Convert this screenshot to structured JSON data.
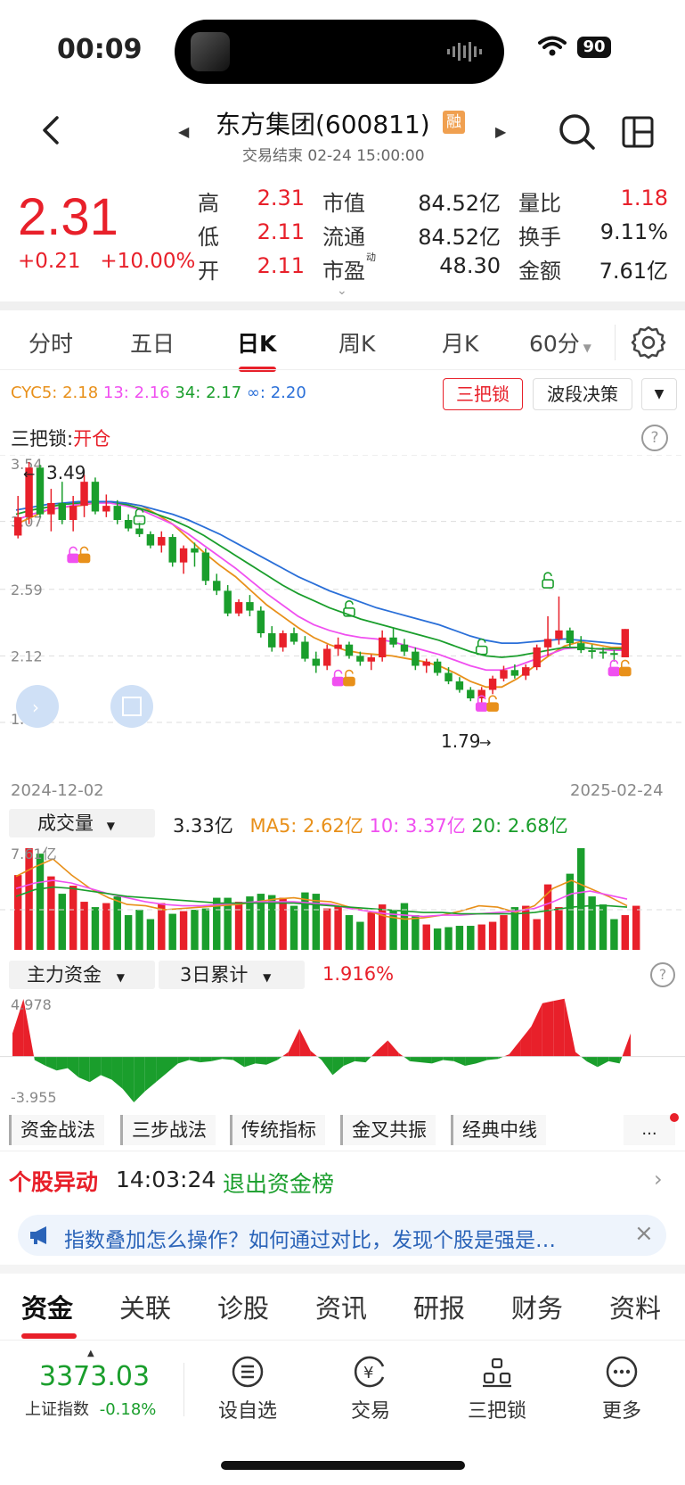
{
  "status_bar": {
    "time": "00:09",
    "battery": "90"
  },
  "header": {
    "title": "东方集团(600811)",
    "badge": "融",
    "trade_status": "交易结束 02-24 15:00:00"
  },
  "quote": {
    "price": "2.31",
    "change": "+0.21   +10.00%",
    "stats": [
      {
        "label": "高",
        "value": "2.31",
        "color": "red"
      },
      {
        "label": "低",
        "value": "2.11",
        "color": "red"
      },
      {
        "label": "开",
        "value": "2.11",
        "color": "red"
      },
      {
        "label": "市值",
        "value": "84.52亿",
        "color": "black"
      },
      {
        "label": "流通",
        "value": "84.52亿",
        "color": "black"
      },
      {
        "label": "市盈",
        "label_sup": "动",
        "value": "48.30",
        "color": "black"
      },
      {
        "label": "量比",
        "value": "1.18",
        "color": "red"
      },
      {
        "label": "换手",
        "value": "9.11%",
        "color": "black"
      },
      {
        "label": "金额",
        "value": "7.61亿",
        "color": "black"
      }
    ]
  },
  "period_tabs": [
    "分时",
    "五日",
    "日K",
    "周K",
    "月K",
    "60分"
  ],
  "active_period": "日K",
  "indicators": {
    "cyc": [
      {
        "text": "CYC5: 2.18",
        "color": "#e8901a"
      },
      {
        "text": "13: 2.16",
        "color": "#f050f0"
      },
      {
        "text": "34: 2.17",
        "color": "#1a9e2c"
      },
      {
        "text": "∞: 2.20",
        "color": "#2a6fd8"
      }
    ],
    "btn_sanbasuo": "三把锁",
    "btn_boduan": "波段决策",
    "sbs_label": "三把锁:",
    "sbs_value": "开仓"
  },
  "kline": {
    "y_labels": [
      "3.54",
      "3.07",
      "2.59",
      "2.12",
      "1.65"
    ],
    "high_label": "3.49",
    "low_label": "1.79",
    "date_start": "2024-12-02",
    "date_end": "2025-02-24"
  },
  "volume": {
    "dropdown": "成交量",
    "value": "3.33亿",
    "ma5": "MA5: 2.62亿",
    "ma10": "10: 3.37亿",
    "ma20": "20: 2.68亿",
    "y_top": "7.61亿"
  },
  "capital": {
    "dropdown1": "主力资金",
    "dropdown2": "3日累计",
    "value": "1.916%",
    "y_top": "4.978",
    "y_bottom": "-3.955"
  },
  "strategy_tabs": [
    "资金战法",
    "三步战法",
    "传统指标",
    "金叉共振",
    "经典中线"
  ],
  "strategy_more": "...",
  "movement": {
    "label": "个股异动",
    "time": "14:03:24",
    "text": "退出资金榜"
  },
  "tip": "指数叠加怎么操作？如何通过对比，发现个股是强是…",
  "bottom_tabs": [
    "资金",
    "关联",
    "诊股",
    "资讯",
    "研报",
    "财务",
    "资料"
  ],
  "nav": {
    "index_value": "3373.03",
    "index_label": "上证指数",
    "index_change": "-0.18%",
    "items": [
      "设自选",
      "交易",
      "三把锁",
      "更多"
    ]
  },
  "colors": {
    "up": "#e8202a",
    "down": "#1a9e2c",
    "accent_blue": "#2a63b8"
  },
  "chart_data": {
    "type": "candlestick",
    "ylim": [
      1.65,
      3.54
    ],
    "candles": [
      [
        2.97,
        3.25,
        2.95,
        3.1
      ],
      [
        3.1,
        3.49,
        3.05,
        3.45
      ],
      [
        3.45,
        3.47,
        3.1,
        3.12
      ],
      [
        3.12,
        3.3,
        3.0,
        3.2
      ],
      [
        3.2,
        3.35,
        3.05,
        3.08
      ],
      [
        3.08,
        3.25,
        3.0,
        3.18
      ],
      [
        3.18,
        3.4,
        3.1,
        3.35
      ],
      [
        3.35,
        3.38,
        3.12,
        3.14
      ],
      [
        3.14,
        3.26,
        3.1,
        3.18
      ],
      [
        3.18,
        3.22,
        3.05,
        3.08
      ],
      [
        3.08,
        3.12,
        3.0,
        3.02
      ],
      [
        3.02,
        3.06,
        2.96,
        2.98
      ],
      [
        2.98,
        3.0,
        2.88,
        2.9
      ],
      [
        2.9,
        3.0,
        2.85,
        2.96
      ],
      [
        2.96,
        2.98,
        2.75,
        2.78
      ],
      [
        2.78,
        2.9,
        2.7,
        2.88
      ],
      [
        2.88,
        2.92,
        2.75,
        2.85
      ],
      [
        2.85,
        2.88,
        2.62,
        2.65
      ],
      [
        2.65,
        2.7,
        2.55,
        2.58
      ],
      [
        2.58,
        2.62,
        2.4,
        2.42
      ],
      [
        2.42,
        2.52,
        2.4,
        2.5
      ],
      [
        2.5,
        2.55,
        2.4,
        2.44
      ],
      [
        2.44,
        2.47,
        2.25,
        2.28
      ],
      [
        2.28,
        2.33,
        2.15,
        2.18
      ],
      [
        2.18,
        2.3,
        2.15,
        2.28
      ],
      [
        2.28,
        2.32,
        2.2,
        2.22
      ],
      [
        2.22,
        2.26,
        2.08,
        2.1
      ],
      [
        2.1,
        2.15,
        2.0,
        2.05
      ],
      [
        2.05,
        2.2,
        2.02,
        2.17
      ],
      [
        2.17,
        2.25,
        2.12,
        2.2
      ],
      [
        2.2,
        2.22,
        2.1,
        2.12
      ],
      [
        2.12,
        2.15,
        2.05,
        2.08
      ],
      [
        2.08,
        2.13,
        2.02,
        2.11
      ],
      [
        2.11,
        2.3,
        2.08,
        2.25
      ],
      [
        2.25,
        2.32,
        2.18,
        2.2
      ],
      [
        2.2,
        2.24,
        2.12,
        2.15
      ],
      [
        2.15,
        2.18,
        2.02,
        2.05
      ],
      [
        2.05,
        2.1,
        2.0,
        2.08
      ],
      [
        2.08,
        2.1,
        1.98,
        2.0
      ],
      [
        2.0,
        2.04,
        1.92,
        1.94
      ],
      [
        1.94,
        1.97,
        1.86,
        1.88
      ],
      [
        1.88,
        1.9,
        1.8,
        1.82
      ],
      [
        1.82,
        1.9,
        1.79,
        1.88
      ],
      [
        1.88,
        1.98,
        1.85,
        1.96
      ],
      [
        1.96,
        2.05,
        1.94,
        2.02
      ],
      [
        2.02,
        2.06,
        1.96,
        1.98
      ],
      [
        1.98,
        2.06,
        1.95,
        2.04
      ],
      [
        2.04,
        2.2,
        2.02,
        2.18
      ],
      [
        2.18,
        2.4,
        2.12,
        2.24
      ],
      [
        2.24,
        2.54,
        2.2,
        2.3
      ],
      [
        2.3,
        2.32,
        2.18,
        2.21
      ],
      [
        2.21,
        2.26,
        2.14,
        2.16
      ],
      [
        2.16,
        2.2,
        2.1,
        2.15
      ],
      [
        2.15,
        2.18,
        2.1,
        2.14
      ],
      [
        2.14,
        2.16,
        2.08,
        2.13
      ],
      [
        2.11,
        2.31,
        2.11,
        2.31
      ]
    ],
    "ma": [
      {
        "name": "CYC5",
        "color": "#e8901a",
        "values": [
          3.05,
          3.1,
          3.15,
          3.17,
          3.18,
          3.2,
          3.21,
          3.2,
          3.18,
          3.12,
          3.05,
          2.95,
          2.85,
          2.76,
          2.68,
          2.58,
          2.48,
          2.4,
          2.32,
          2.25,
          2.2,
          2.16,
          2.14,
          2.13,
          2.12,
          2.1,
          2.08,
          2.05,
          2.0,
          1.94,
          1.9,
          1.9,
          1.96,
          2.04,
          2.12,
          2.19,
          2.22,
          2.2,
          2.18,
          2.18
        ]
      },
      {
        "name": "13",
        "color": "#f050f0",
        "values": [
          3.08,
          3.12,
          3.15,
          3.17,
          3.19,
          3.2,
          3.2,
          3.18,
          3.15,
          3.1,
          3.05,
          2.98,
          2.9,
          2.82,
          2.74,
          2.65,
          2.56,
          2.48,
          2.4,
          2.34,
          2.3,
          2.27,
          2.25,
          2.24,
          2.22,
          2.19,
          2.16,
          2.13,
          2.09,
          2.05,
          2.02,
          2.02,
          2.05,
          2.09,
          2.13,
          2.17,
          2.18,
          2.17,
          2.16,
          2.16
        ]
      },
      {
        "name": "34",
        "color": "#1a9e2c",
        "values": [
          3.12,
          3.15,
          3.17,
          3.19,
          3.2,
          3.21,
          3.21,
          3.19,
          3.16,
          3.12,
          3.08,
          3.03,
          2.97,
          2.9,
          2.83,
          2.76,
          2.69,
          2.62,
          2.56,
          2.51,
          2.46,
          2.42,
          2.38,
          2.35,
          2.32,
          2.29,
          2.26,
          2.23,
          2.19,
          2.15,
          2.12,
          2.11,
          2.12,
          2.14,
          2.16,
          2.18,
          2.18,
          2.17,
          2.17,
          2.17
        ]
      },
      {
        "name": "∞",
        "color": "#2a6fd8",
        "values": [
          3.15,
          3.17,
          3.19,
          3.2,
          3.21,
          3.21,
          3.21,
          3.2,
          3.18,
          3.15,
          3.12,
          3.08,
          3.03,
          2.98,
          2.92,
          2.86,
          2.8,
          2.74,
          2.68,
          2.63,
          2.58,
          2.54,
          2.5,
          2.46,
          2.43,
          2.4,
          2.37,
          2.34,
          2.3,
          2.26,
          2.23,
          2.21,
          2.21,
          2.22,
          2.23,
          2.24,
          2.23,
          2.22,
          2.21,
          2.2
        ]
      }
    ],
    "volume": [
      5.6,
      7.61,
      7.2,
      5.5,
      4.2,
      4.8,
      3.6,
      3.2,
      3.5,
      4.0,
      2.6,
      3.0,
      2.3,
      3.5,
      2.7,
      2.9,
      3.0,
      3.1,
      3.9,
      3.9,
      3.6,
      4.0,
      4.2,
      4.1,
      3.9,
      3.3,
      4.3,
      4.2,
      3.1,
      3.3,
      2.6,
      2.1,
      2.8,
      3.4,
      3.0,
      3.5,
      2.6,
      1.9,
      1.6,
      1.7,
      1.8,
      1.8,
      1.9,
      2.1,
      2.6,
      3.2,
      3.3,
      2.3,
      4.9,
      3.2,
      5.7,
      7.61,
      4.0,
      3.4,
      2.3,
      2.6,
      3.3
    ],
    "capital_flow": [
      2.0,
      4.978,
      -0.3,
      -0.8,
      -1.2,
      -1.0,
      -1.8,
      -2.2,
      -1.6,
      -2.0,
      -2.8,
      -3.955,
      -3.0,
      -2.2,
      -1.4,
      -0.6,
      -0.3,
      -0.5,
      -0.4,
      -0.2,
      -0.3,
      -0.9,
      -0.6,
      -0.7,
      -0.3,
      0.4,
      2.4,
      0.5,
      -0.3,
      -1.6,
      -0.8,
      -0.4,
      -0.5,
      0.5,
      1.4,
      0.3,
      -0.4,
      -0.5,
      -0.6,
      -0.3,
      -0.4,
      -0.8,
      -0.6,
      -0.3,
      -0.2,
      0.2,
      1.4,
      2.6,
      4.6,
      4.8,
      5.0,
      0.4,
      -0.4,
      -0.9,
      -0.4,
      -0.6,
      2.0
    ]
  }
}
